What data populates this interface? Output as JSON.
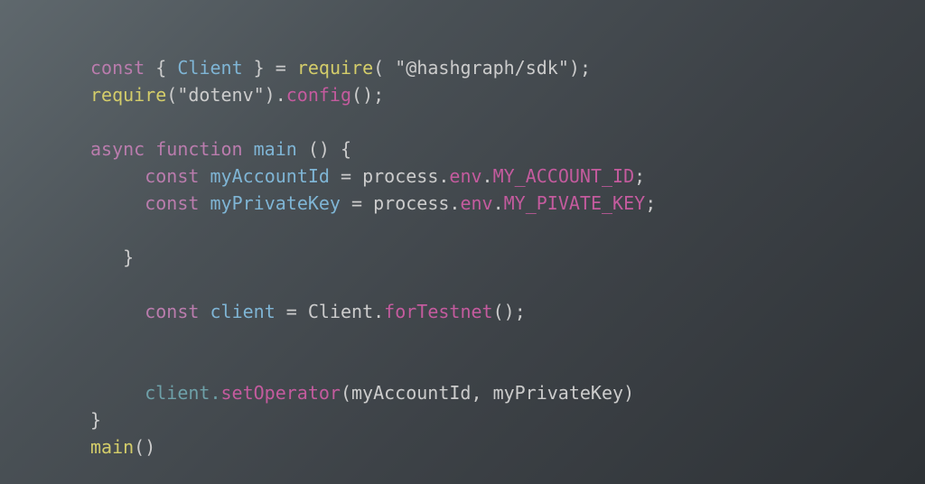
{
  "tokens": {
    "kw_const": "const",
    "kw_async": "async",
    "kw_function": "function",
    "id_Client": "Client",
    "id_myAccountId": "myAccountId",
    "id_myPrivateKey": "myPrivateKey",
    "id_main": "main",
    "id_client": "client",
    "id_process": "process",
    "fn_require": "require",
    "m_config": "config",
    "m_env": "env",
    "m_forTestnet": "forTestnet",
    "m_setOperator": "setOperator",
    "p_MY_ACCOUNT_ID": "MY_ACCOUNT_ID",
    "p_MY_PIVATE_KEY": "MY_PIVATE_KEY",
    "s_sdk": "\"@hashgraph/sdk\"",
    "s_dotenv": "\"dotenv\"",
    "brace_open": "{",
    "brace_close": "}",
    "paren_open": "(",
    "paren_close": ")",
    "assign": "=",
    "dot": ".",
    "semi": ";",
    "comma": ","
  }
}
